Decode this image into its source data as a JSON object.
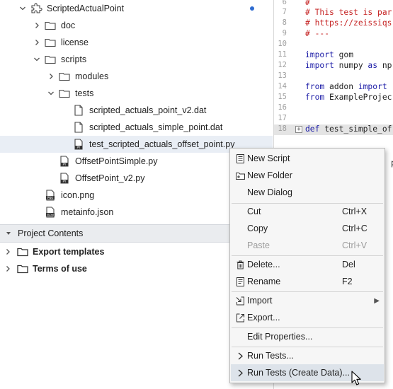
{
  "tree": {
    "items": [
      {
        "label": "ScriptedActualPoint",
        "icon": "puzzle-icon",
        "expanded": true,
        "modified_dot": true
      },
      {
        "label": "doc",
        "icon": "folder-icon",
        "expanded": false
      },
      {
        "label": "license",
        "icon": "folder-icon",
        "expanded": false
      },
      {
        "label": "scripts",
        "icon": "folder-icon",
        "expanded": true
      },
      {
        "label": "modules",
        "icon": "folder-icon",
        "expanded": false
      },
      {
        "label": "tests",
        "icon": "folder-icon",
        "expanded": true
      },
      {
        "label": "scripted_actuals_point_v2.dat",
        "icon": "file-icon"
      },
      {
        "label": "scripted_actuals_simple_point.dat",
        "icon": "file-icon"
      },
      {
        "label": "test_scripted_actuals_offset_point.py",
        "icon": "python-file-icon",
        "selected": true
      },
      {
        "label": "OffsetPointSimple.py",
        "icon": "python-file-icon"
      },
      {
        "label": "OffsetPoint_v2.py",
        "icon": "python-file-icon"
      },
      {
        "label": "icon.png",
        "icon": "png-file-icon"
      },
      {
        "label": "metainfo.json",
        "icon": "json-file-icon"
      }
    ],
    "section_title": "Project Contents",
    "section_items": [
      {
        "label": "Export templates"
      },
      {
        "label": "Terms of use"
      }
    ]
  },
  "editor": {
    "lines": [
      {
        "num": "6",
        "text": "#"
      },
      {
        "num": "7",
        "text": "# This test is par"
      },
      {
        "num": "8",
        "text": "# https://zeissiqs"
      },
      {
        "num": "9",
        "text": "# ---"
      },
      {
        "num": "10",
        "text": ""
      },
      {
        "num": "11",
        "kw": "import",
        "rest": " gom"
      },
      {
        "num": "12",
        "kw": "import",
        "rest": " numpy ",
        "kw2": "as",
        "rest2": " np"
      },
      {
        "num": "13",
        "text": ""
      },
      {
        "num": "14",
        "kw": "from",
        "rest": " addon ",
        "kw2": "import",
        "rest2": ""
      },
      {
        "num": "15",
        "kw": "from",
        "rest": " ExampleProjec"
      },
      {
        "num": "16",
        "text": ""
      },
      {
        "num": "17",
        "text": ""
      },
      {
        "num": "18",
        "kw": "def",
        "rest": " test_simple_of",
        "fold": "+"
      }
    ],
    "fragment": "po"
  },
  "menu": {
    "items": [
      {
        "label": "New Script",
        "icon": "new-script-icon"
      },
      {
        "label": "New Folder",
        "icon": "new-folder-icon"
      },
      {
        "label": "New Dialog",
        "icon": ""
      },
      {
        "label": "Cut",
        "shortcut": "Ctrl+X"
      },
      {
        "label": "Copy",
        "shortcut": "Ctrl+C"
      },
      {
        "label": "Paste",
        "shortcut": "Ctrl+V",
        "disabled": true
      },
      {
        "label": "Delete...",
        "shortcut": "Del",
        "icon": "trash-icon"
      },
      {
        "label": "Rename",
        "shortcut": "F2",
        "icon": "rename-icon"
      },
      {
        "label": "Import",
        "icon": "import-icon",
        "submenu": true
      },
      {
        "label": "Export...",
        "icon": "export-icon"
      },
      {
        "label": "Edit Properties..."
      },
      {
        "label": "Run Tests...",
        "icon": "chevron-right-icon"
      },
      {
        "label": "Run Tests (Create Data)...",
        "icon": "chevron-right-icon",
        "hover": true
      }
    ]
  },
  "colors": {
    "comment": "#c52222",
    "keyword": "#1a1aa6",
    "selection": "#e9eef5",
    "menu_hover": "#dde3ea",
    "modified_dot": "#2d6bd0"
  }
}
